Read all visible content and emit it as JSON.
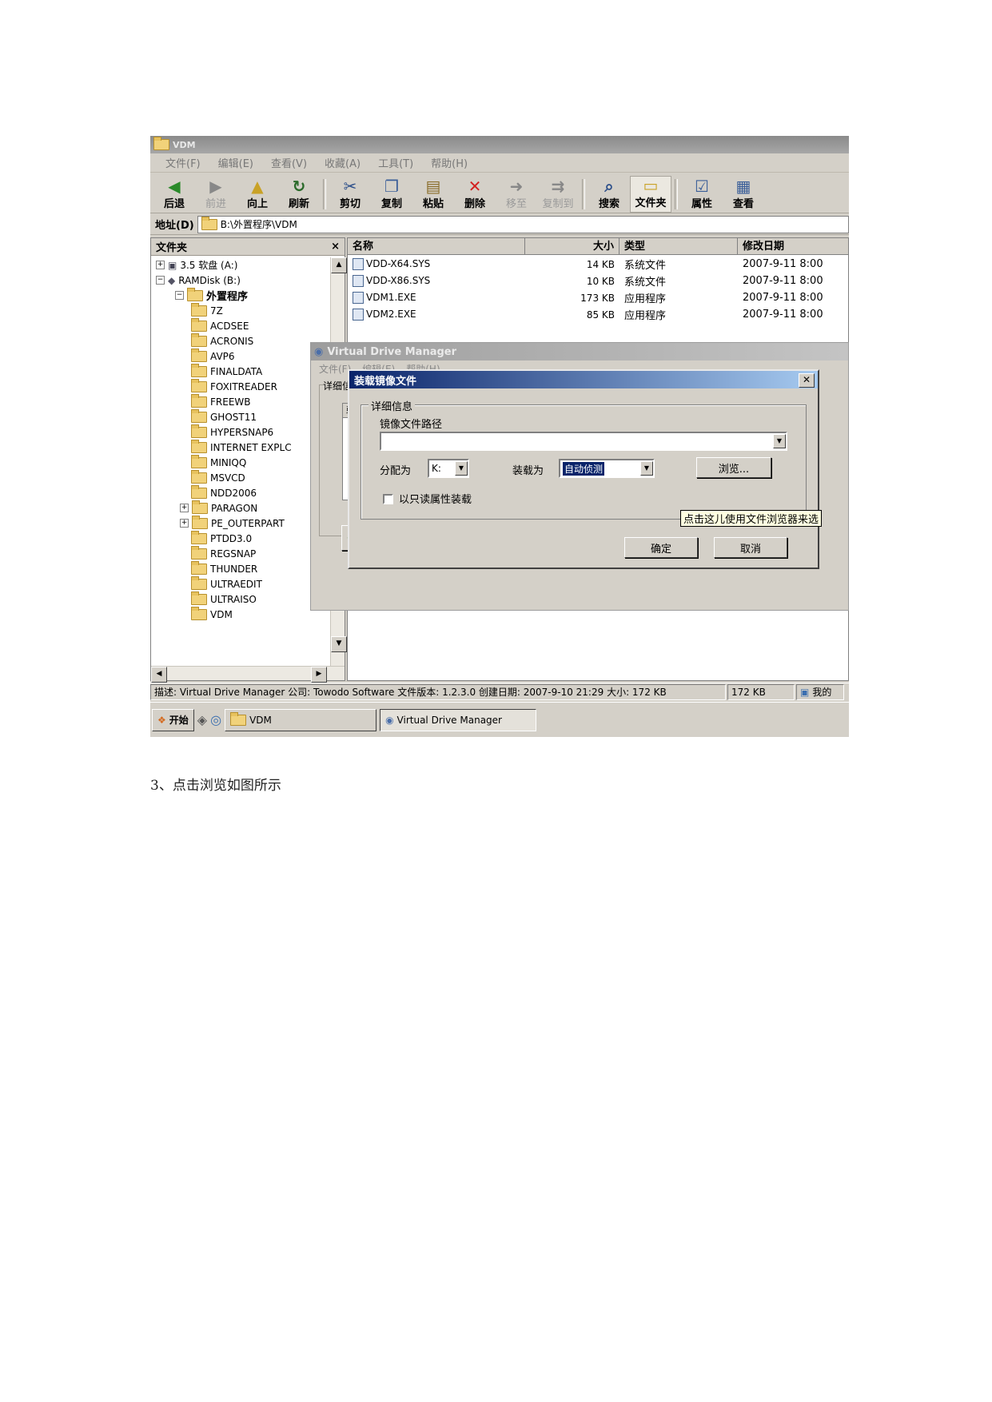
{
  "window": {
    "title": "VDM",
    "menu": [
      "文件(F)",
      "编辑(E)",
      "查看(V)",
      "收藏(A)",
      "工具(T)",
      "帮助(H)"
    ],
    "toolbar": {
      "back": "后退",
      "forward": "前进",
      "up": "向上",
      "refresh": "刷新",
      "cut": "剪切",
      "copy": "复制",
      "paste": "粘贴",
      "delete": "删除",
      "move_to": "移至",
      "copy_to": "复制到",
      "search": "搜索",
      "folders": "文件夹",
      "properties": "属性",
      "view": "查看"
    },
    "address_label": "地址(D)",
    "address_value": "B:\\外置程序\\VDM"
  },
  "folder_pane": {
    "title": "文件夹",
    "close": "×",
    "tree": {
      "drive_a": "3.5 软盘 (A:)",
      "drive_b": "RAMDisk (B:)",
      "parent": "外置程序",
      "children": [
        "7Z",
        "ACDSEE",
        "ACRONIS",
        "AVP6",
        "FINALDATA",
        "FOXITREADER",
        "FREEWB",
        "GHOST11",
        "HYPERSNAP6",
        "INTERNET EXPLC",
        "MINIQQ",
        "MSVCD",
        "NDD2006",
        "PARAGON",
        "PE_OUTERPART",
        "PTDD3.0",
        "REGSNAP",
        "THUNDER",
        "ULTRAEDIT",
        "ULTRAISO",
        "VDM"
      ]
    }
  },
  "file_list": {
    "columns": {
      "name": "名称",
      "size": "大小",
      "type": "类型",
      "modified": "修改日期"
    },
    "rows": [
      {
        "name": "VDD-X64.SYS",
        "size": "14 KB",
        "type": "系统文件",
        "modified": "2007-9-11 8:00"
      },
      {
        "name": "VDD-X86.SYS",
        "size": "10 KB",
        "type": "系统文件",
        "modified": "2007-9-11 8:00"
      },
      {
        "name": "VDM1.EXE",
        "size": "173 KB",
        "type": "应用程序",
        "modified": "2007-9-11 8:00"
      },
      {
        "name": "VDM2.EXE",
        "size": "85 KB",
        "type": "应用程序",
        "modified": "2007-9-11 8:00"
      }
    ]
  },
  "vdm_window": {
    "title": "Virtual Drive Manager",
    "menu": [
      "文件(F)",
      "编辑(E)",
      "帮助(H)"
    ],
    "group_label": "详细信",
    "col_label": "驱"
  },
  "mount_dialog": {
    "title": "装载镜像文件",
    "group": "详细信息",
    "path_label": "镜像文件路径",
    "path_value": "",
    "assign_label": "分配为",
    "assign_value": "K:",
    "load_label": "装载为",
    "load_value": "自动侦测",
    "browse": "浏览...",
    "readonly": "以只读属性装载",
    "tooltip": "点击这儿使用文件浏览器来选",
    "ok": "确定",
    "cancel": "取消"
  },
  "statusbar": {
    "description": "描述: Virtual Drive Manager 公司: Towodo Software 文件版本: 1.2.3.0 创建日期: 2007-9-10 21:29 大小: 172 KB",
    "size": "172 KB",
    "zone": "我的"
  },
  "taskbar": {
    "start": "开始",
    "task_vdm": "VDM",
    "task_manager": "Virtual Drive Manager"
  },
  "caption": "3、点击浏览如图所示",
  "colors": {
    "dialog_title": "#0a246a",
    "selection": "#0a246a",
    "tooltip_bg": "#ffffe1",
    "face": "#d4d0c8"
  }
}
